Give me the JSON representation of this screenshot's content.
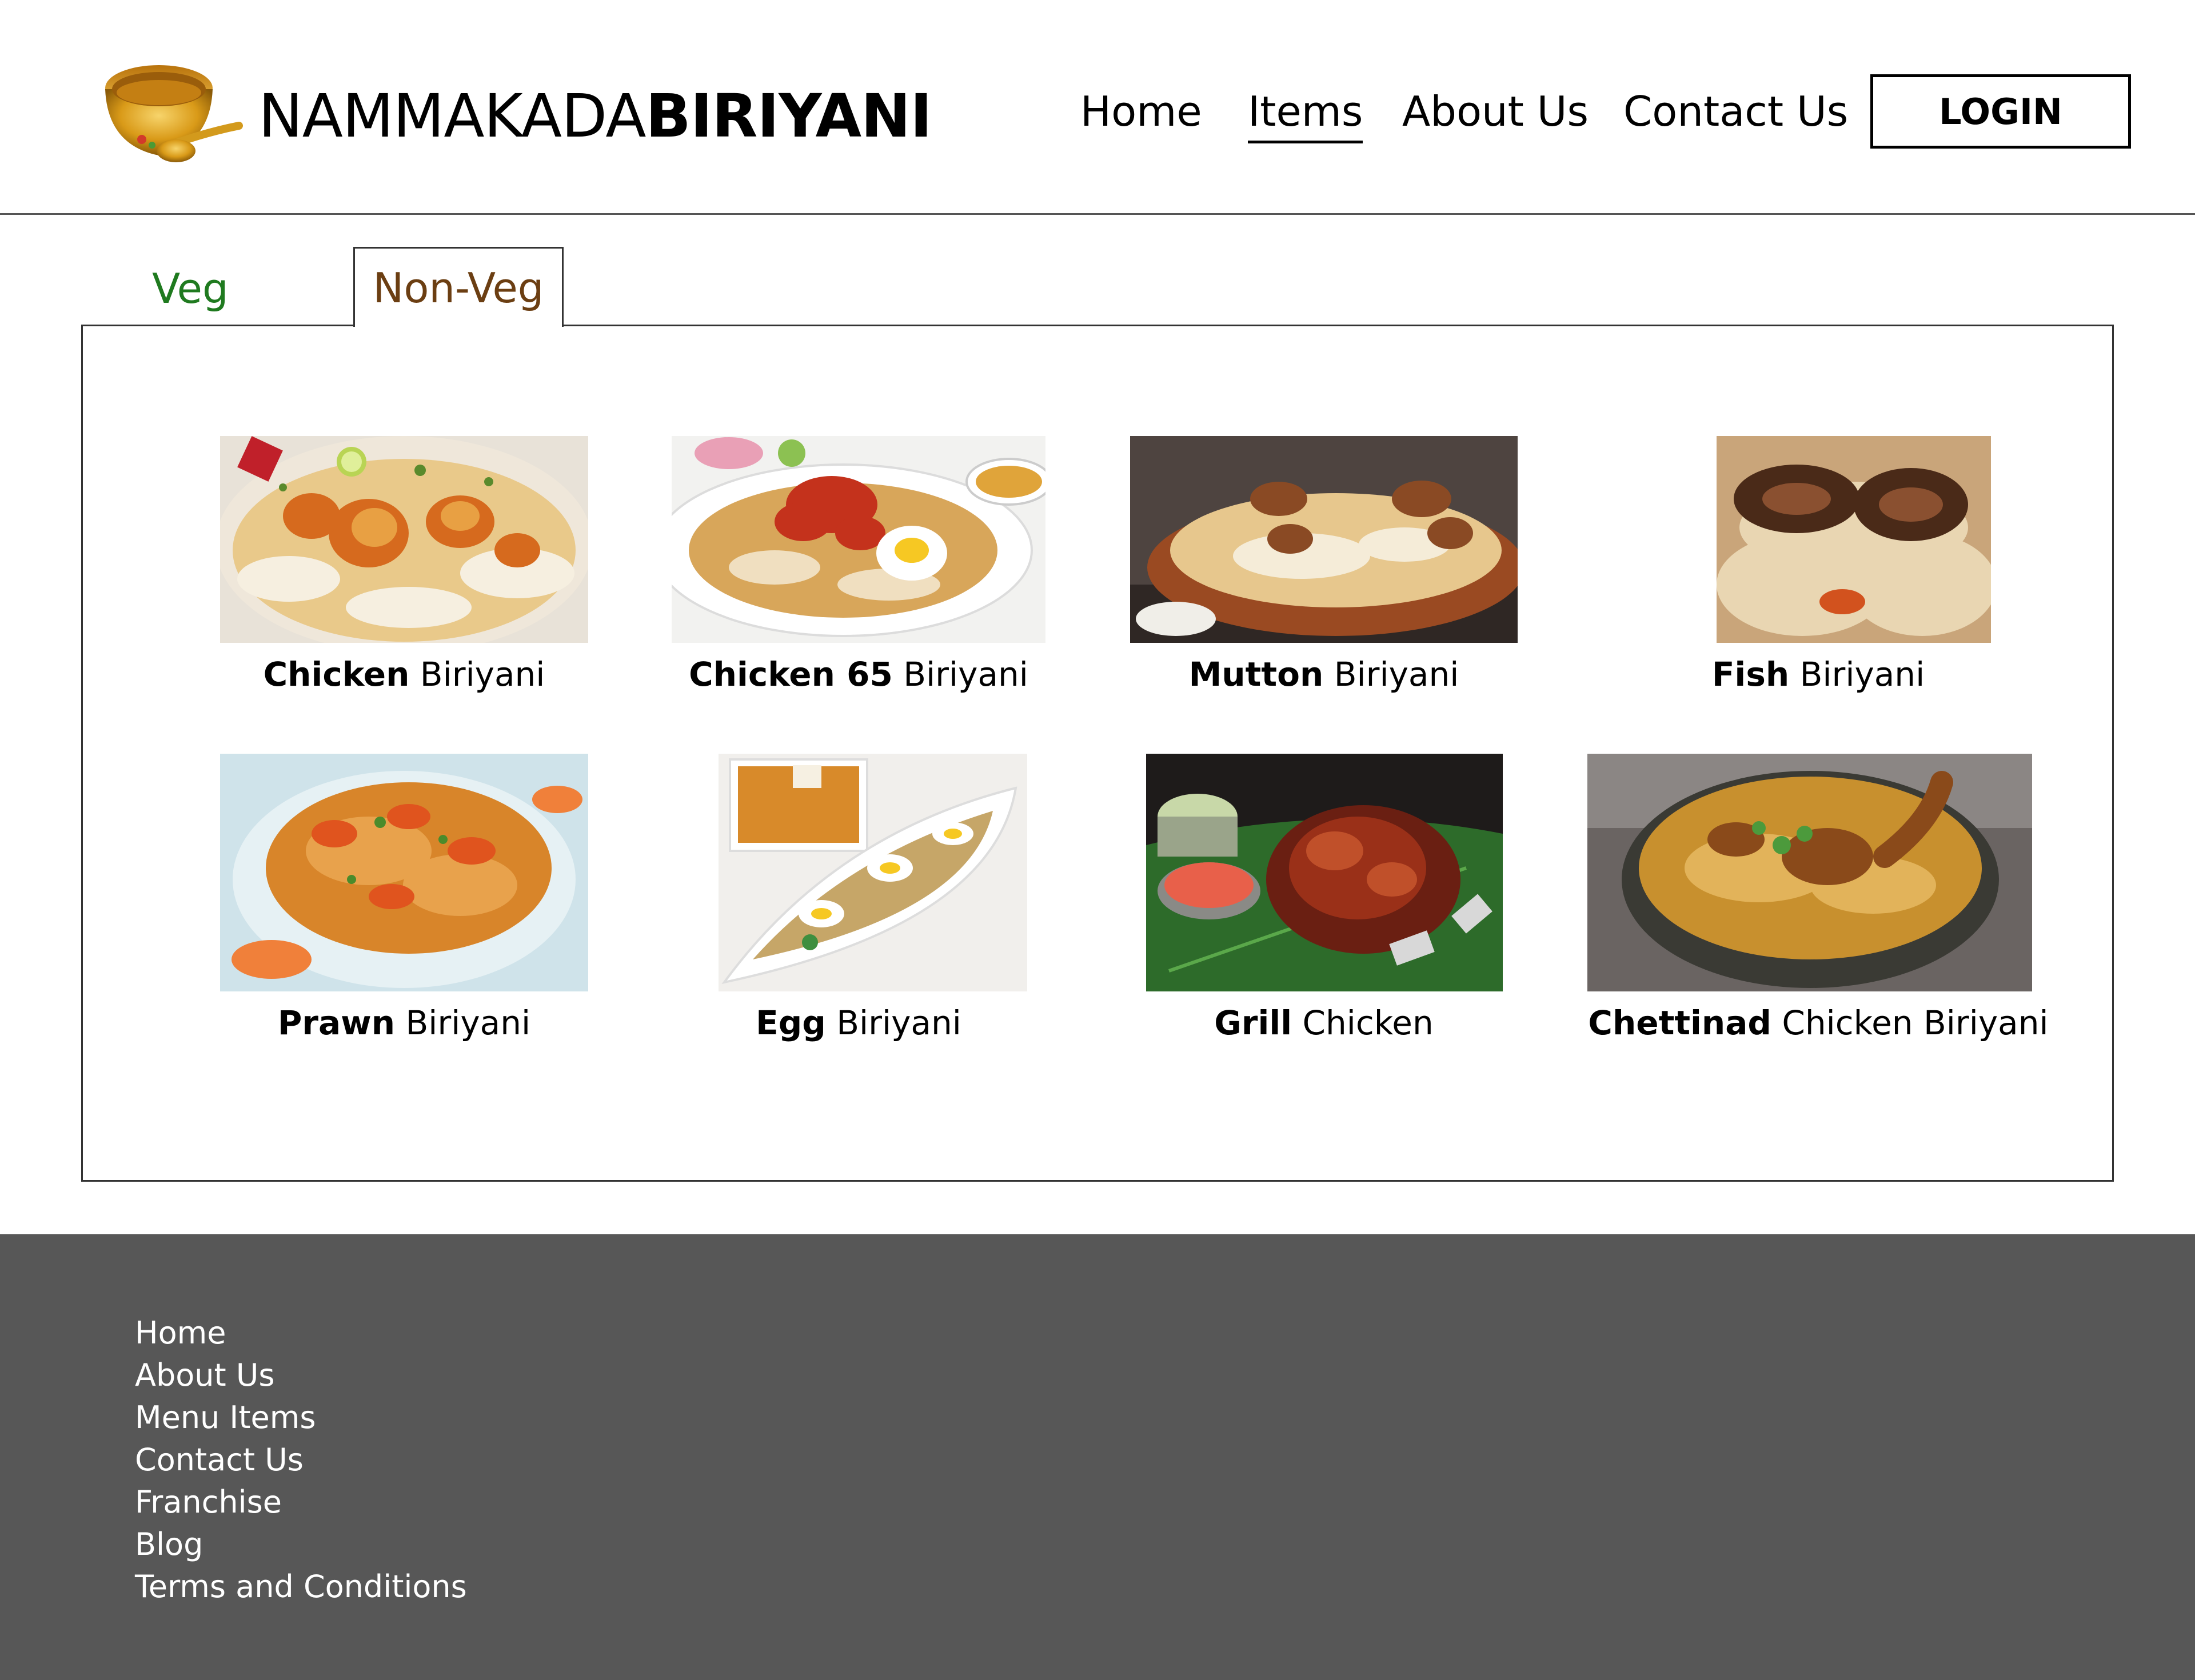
{
  "brand": {
    "name_light": "NAMMAKADA",
    "name_bold": "BIRIYANI",
    "logo_icon": "golden-bowl-and-spoon"
  },
  "nav": {
    "items": [
      {
        "label": "Home"
      },
      {
        "label": "Items",
        "active": true
      },
      {
        "label": "About Us"
      },
      {
        "label": "Contact Us"
      }
    ],
    "login_label": "LOGIN"
  },
  "tabs": {
    "veg_label": "Veg",
    "nonveg_label": "Non-Veg",
    "selected": "Non-Veg"
  },
  "menu": {
    "items": [
      {
        "bold": "Chicken",
        "rest": " Biriyani"
      },
      {
        "bold": "Chicken 65",
        "rest": " Biriyani"
      },
      {
        "bold": "Mutton",
        "rest": " Biriyani"
      },
      {
        "bold": "Fish",
        "rest": " Biriyani"
      },
      {
        "bold": "Prawn",
        "rest": " Biriyani"
      },
      {
        "bold": "Egg",
        "rest": " Biriyani"
      },
      {
        "bold": "Grill",
        "rest": " Chicken"
      },
      {
        "bold": "Chettinad",
        "rest": " Chicken Biriyani"
      }
    ]
  },
  "footer": {
    "links": [
      "Home",
      "About Us",
      "Menu Items",
      "Contact Us",
      "Franchise",
      "Blog",
      "Terms and Conditions"
    ]
  },
  "colors": {
    "veg_tab": "#1f7a1f",
    "nonveg_tab": "#6b3e12",
    "footer_bg": "#575757"
  }
}
